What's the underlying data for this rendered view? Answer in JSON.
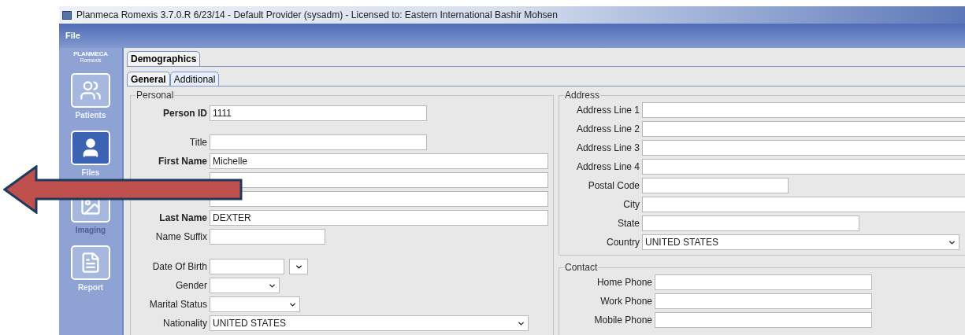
{
  "window": {
    "title": "Planmeca Romexis 3.7.0.R  6/23/14 - Default Provider (sysadm) - Licensed to: Eastern International Bashir Mohsen"
  },
  "menu": [
    "File"
  ],
  "sidebar": {
    "logo": "PLANMECA",
    "logo_sub": "Romexis",
    "items": [
      {
        "kind": "patients",
        "label": "Patients",
        "selected": false,
        "disabled": false
      },
      {
        "kind": "files",
        "label": "Files",
        "selected": true,
        "disabled": false
      },
      {
        "kind": "imaging",
        "label": "Imaging",
        "selected": false,
        "disabled": true
      },
      {
        "kind": "report",
        "label": "Report",
        "selected": false,
        "disabled": false
      }
    ]
  },
  "tabs": [
    {
      "label": "Demographics",
      "selected": true
    }
  ],
  "subtabs": [
    {
      "label": "General",
      "selected": true
    },
    {
      "label": "Additional",
      "selected": false
    }
  ],
  "personal": {
    "title": "Personal",
    "fields": [
      {
        "kind": "text",
        "label": "Person ID",
        "value": "1111",
        "required": true
      },
      {
        "kind": "text",
        "label": "Title",
        "required": false
      },
      {
        "kind": "text",
        "label": "First Name",
        "value": "Michelle",
        "required": true
      },
      {
        "kind": "text"
      },
      {
        "kind": "text"
      },
      {
        "kind": "text",
        "label": "Last Name",
        "value": "DEXTER",
        "required": true
      },
      {
        "kind": "text",
        "label": "Name Suffix",
        "required": false
      },
      {
        "kind": "date",
        "label": "Date Of Birth",
        "required": false
      },
      {
        "kind": "select",
        "label": "Gender",
        "required": false
      },
      {
        "kind": "select",
        "label": "Marital Status",
        "required": false
      },
      {
        "kind": "select",
        "label": "Nationality",
        "value": "UNITED STATES",
        "required": false
      }
    ]
  },
  "address": {
    "title": "Address",
    "fields": [
      {
        "kind": "text",
        "label": "Address Line 1"
      },
      {
        "kind": "text",
        "label": "Address Line 2"
      },
      {
        "kind": "text",
        "label": "Address Line 3"
      },
      {
        "kind": "text",
        "label": "Address Line 4"
      },
      {
        "kind": "text",
        "label": "Postal Code"
      },
      {
        "kind": "text",
        "label": "City"
      },
      {
        "kind": "text",
        "label": "State"
      },
      {
        "kind": "select",
        "label": "Country",
        "value": "UNITED STATES"
      }
    ]
  },
  "contact": {
    "title": "Contact",
    "fields": [
      {
        "kind": "text",
        "label": "Home Phone"
      },
      {
        "kind": "text",
        "label": "Work Phone"
      },
      {
        "kind": "text",
        "label": "Mobile Phone"
      }
    ]
  }
}
